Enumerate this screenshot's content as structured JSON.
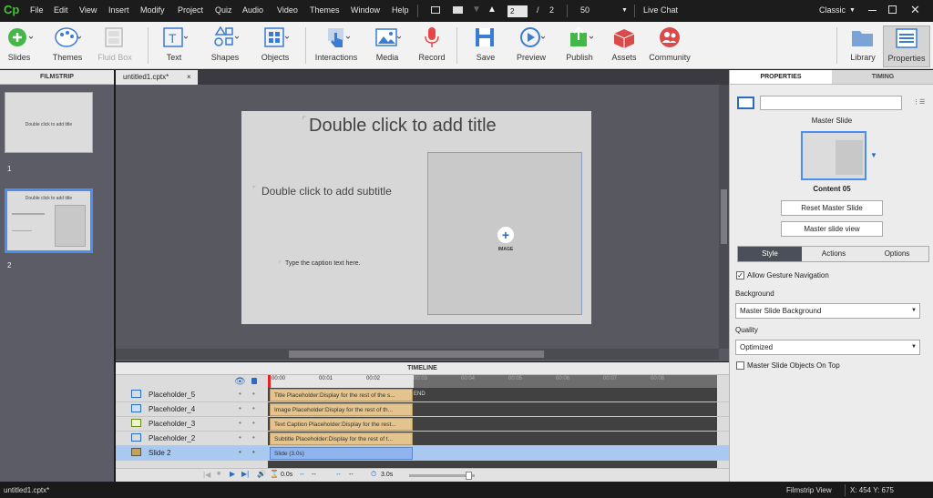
{
  "menu": {
    "logo": "Cp",
    "items": [
      "File",
      "Edit",
      "View",
      "Insert",
      "Modify",
      "Project",
      "Quiz",
      "Audio",
      "Video",
      "Themes",
      "Window",
      "Help"
    ],
    "page_current": "2",
    "page_sep": "/",
    "page_total": "2",
    "zoom": "50",
    "live_chat": "Live Chat",
    "workspace": "Classic"
  },
  "toolbar": {
    "slides": "Slides",
    "themes": "Themes",
    "fluidbox": "Fluid Box",
    "text": "Text",
    "shapes": "Shapes",
    "objects": "Objects",
    "interactions": "Interactions",
    "media": "Media",
    "record": "Record",
    "save": "Save",
    "preview": "Preview",
    "publish": "Publish",
    "assets": "Assets",
    "community": "Community",
    "library": "Library",
    "properties": "Properties"
  },
  "filmstrip": {
    "header": "FILMSTRIP",
    "slides": [
      {
        "number": "1",
        "title": "Double click to add title"
      },
      {
        "number": "2",
        "title": "Double click to add title"
      }
    ]
  },
  "document": {
    "tab": "untitled1.cptx*",
    "title_placeholder": "Double click to add title",
    "subtitle_placeholder": "Double click to add subtitle",
    "caption_placeholder": "Type the caption text here.",
    "image_label": "IMAGE"
  },
  "timeline": {
    "header": "TIMELINE",
    "ticks": [
      "00:00",
      "00:01",
      "00:02",
      "00:03",
      "00:04",
      "00:05",
      "00:06",
      "00:07",
      "00:08"
    ],
    "end_label": "END",
    "rows": [
      {
        "name": "Placeholder_5",
        "bar": "Title Placeholder:Display for the rest of the s..."
      },
      {
        "name": "Placeholder_4",
        "bar": "Image Placeholder:Display for the rest of th..."
      },
      {
        "name": "Placeholder_3",
        "bar": "Text Caption Placeholder:Display for the rest..."
      },
      {
        "name": "Placeholder_2",
        "bar": "Subtitle Placeholder:Display for the rest of t..."
      },
      {
        "name": "Slide 2",
        "bar": "Slide (3.0s)"
      }
    ],
    "time_current": "0.0s",
    "time_slide": "3.0s",
    "dashes1": "--",
    "dashes2": "--"
  },
  "properties": {
    "tab_properties": "PROPERTIES",
    "tab_timing": "TIMING",
    "master_slide_label": "Master Slide",
    "master_name": "Content 05",
    "reset_button": "Reset Master Slide",
    "view_button": "Master slide view",
    "subtabs": [
      "Style",
      "Actions",
      "Options"
    ],
    "allow_gesture": "Allow Gesture Navigation",
    "background_label": "Background",
    "background_value": "Master Slide Background",
    "quality_label": "Quality",
    "quality_value": "Optimized",
    "master_on_top": "Master Slide Objects On Top"
  },
  "status": {
    "file": "untitled1.cptx*",
    "view": "Filmstrip View",
    "coords": "X: 454 Y: 675"
  },
  "colors": {
    "accent": "#2f7fd8",
    "logo": "#3ec72b",
    "bar": "#e3c48e",
    "selected_row": "#a9c9f1"
  }
}
